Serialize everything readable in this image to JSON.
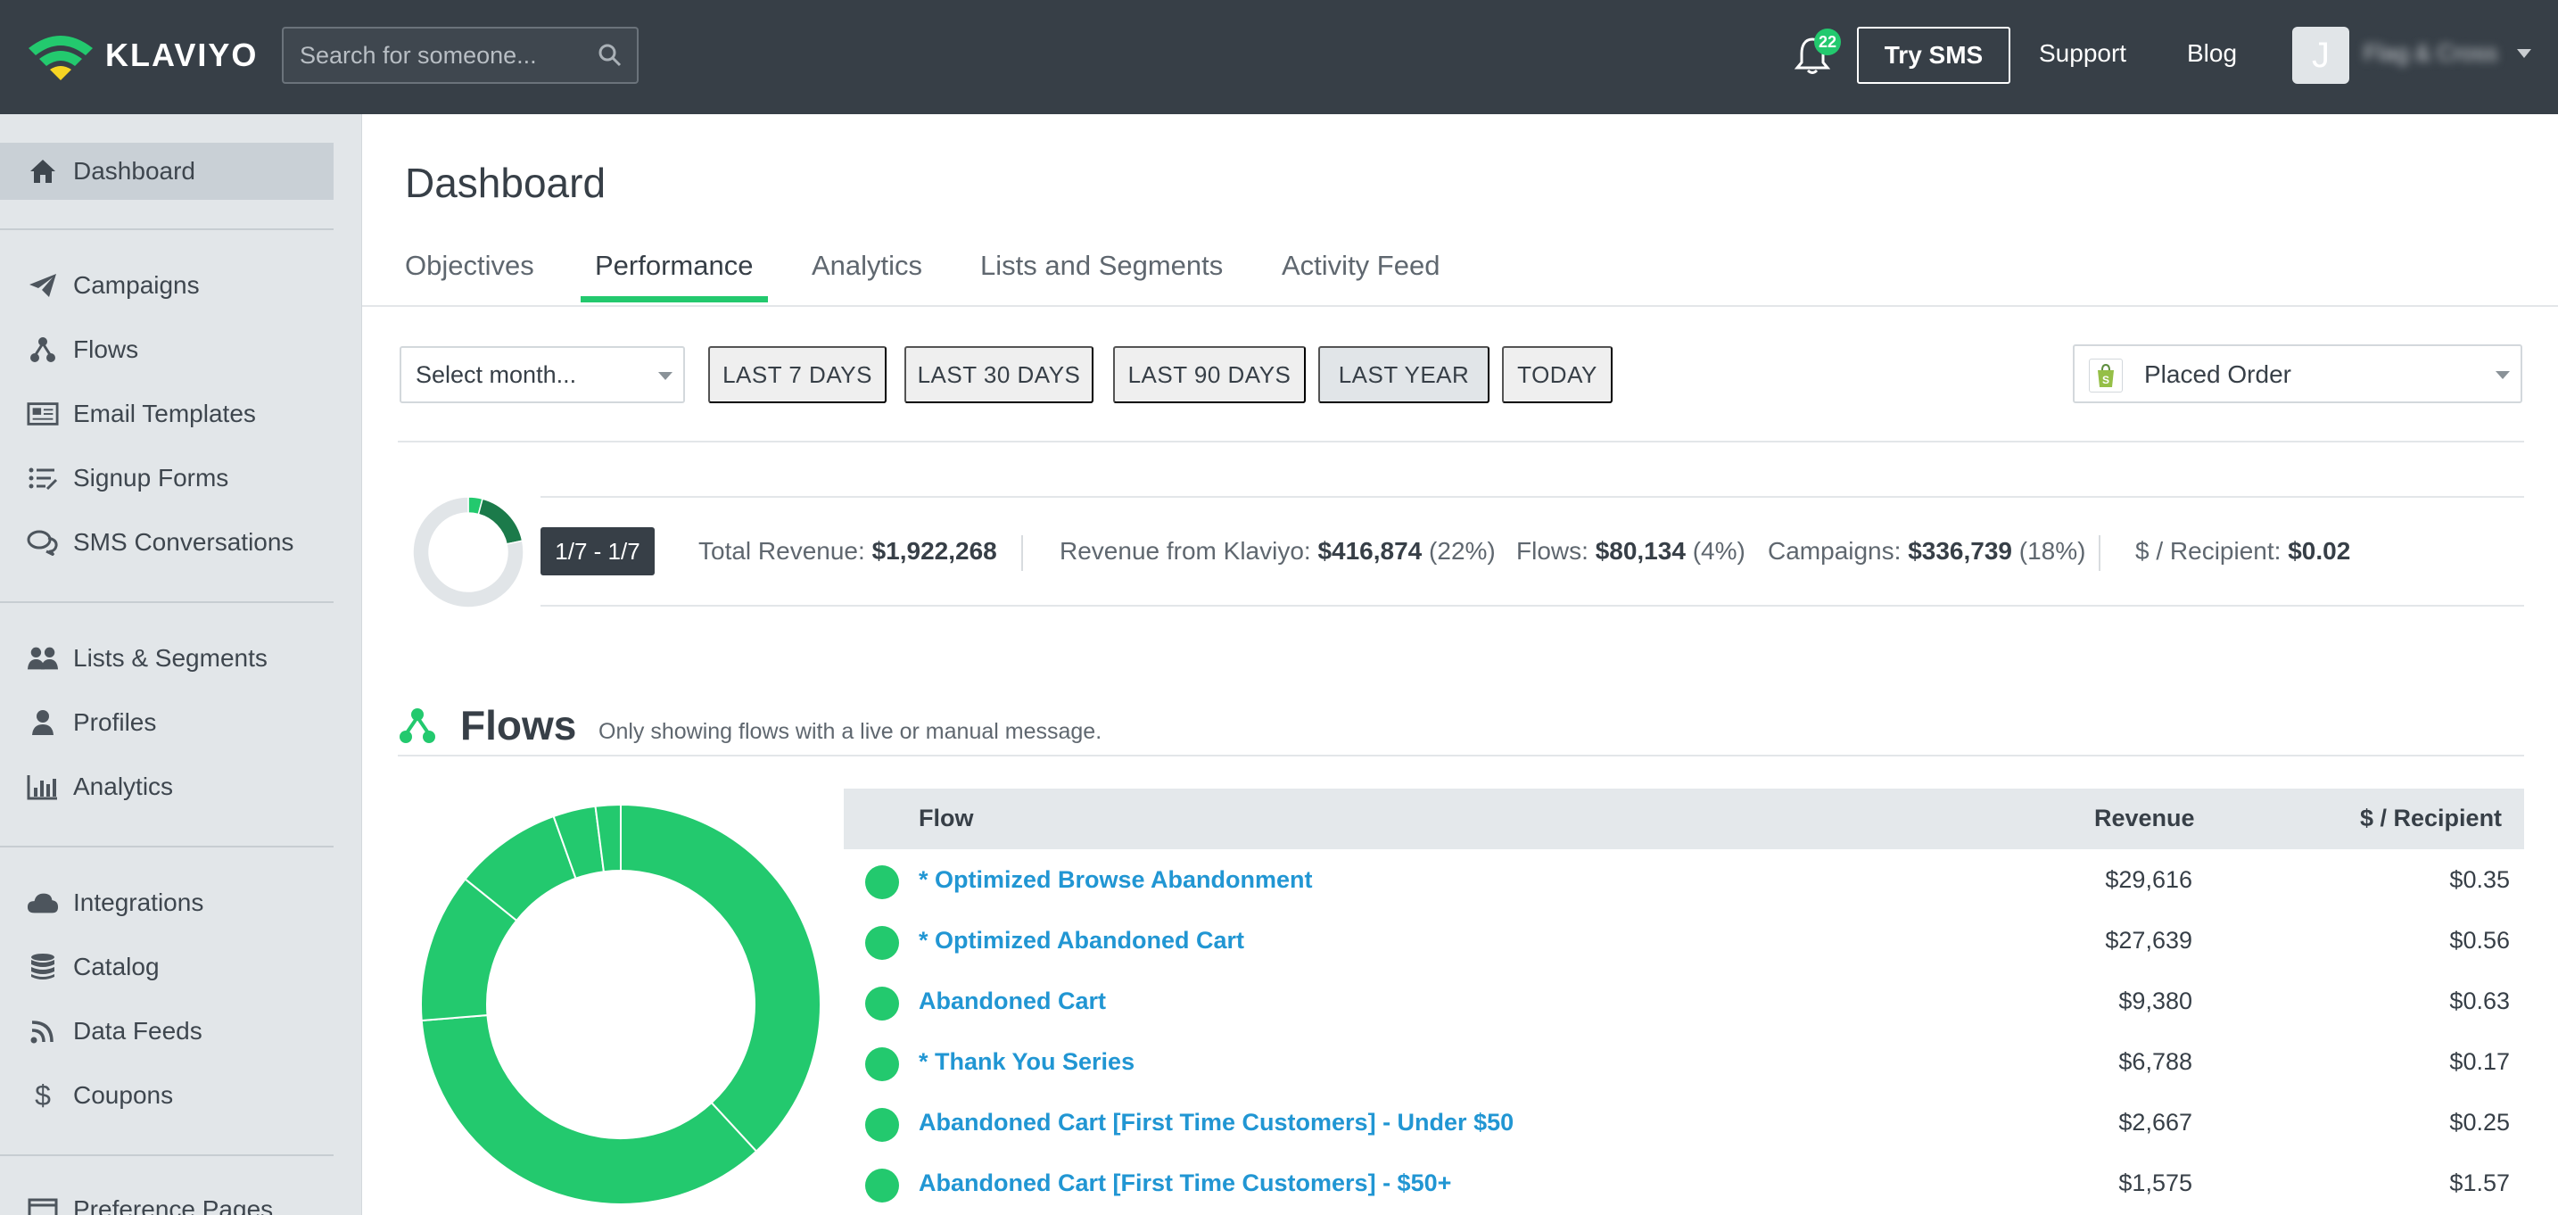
{
  "header": {
    "logo_text": "KLAVIYO",
    "search_placeholder": "Search for someone...",
    "notification_count": "22",
    "try_sms": "Try SMS",
    "support": "Support",
    "blog": "Blog",
    "avatar_initial": "J",
    "account_name": "Flag & Cross"
  },
  "sidebar": {
    "items": [
      {
        "label": "Dashboard",
        "icon": "home-icon"
      },
      {
        "label": "Campaigns",
        "icon": "paper-plane-icon"
      },
      {
        "label": "Flows",
        "icon": "flows-icon"
      },
      {
        "label": "Email Templates",
        "icon": "newspaper-icon"
      },
      {
        "label": "Signup Forms",
        "icon": "form-list-icon"
      },
      {
        "label": "SMS Conversations",
        "icon": "chat-bubbles-icon"
      },
      {
        "label": "Lists & Segments",
        "icon": "users-icon"
      },
      {
        "label": "Profiles",
        "icon": "user-icon"
      },
      {
        "label": "Analytics",
        "icon": "bar-chart-icon"
      },
      {
        "label": "Integrations",
        "icon": "cloud-icon"
      },
      {
        "label": "Catalog",
        "icon": "database-icon"
      },
      {
        "label": "Data Feeds",
        "icon": "rss-icon"
      },
      {
        "label": "Coupons",
        "icon": "dollar-icon"
      },
      {
        "label": "Preference Pages",
        "icon": "page-icon"
      }
    ]
  },
  "page": {
    "title": "Dashboard",
    "tabs": [
      "Objectives",
      "Performance",
      "Analytics",
      "Lists and Segments",
      "Activity Feed"
    ],
    "active_tab": "Performance"
  },
  "filters": {
    "month_placeholder": "Select month...",
    "ranges": [
      "LAST 7 DAYS",
      "LAST 30 DAYS",
      "LAST 90 DAYS",
      "LAST YEAR",
      "TODAY"
    ],
    "active_range": "LAST YEAR",
    "metric": "Placed Order"
  },
  "summary": {
    "date_range": "1/7 - 1/7",
    "total_revenue_label": "Total Revenue:",
    "total_revenue": "$1,922,268",
    "klaviyo_label": "Revenue from Klaviyo:",
    "klaviyo_revenue": "$416,874",
    "klaviyo_pct": "(22%)",
    "flows_label": "Flows:",
    "flows_revenue": "$80,134",
    "flows_pct": "(4%)",
    "campaigns_label": "Campaigns:",
    "campaigns_revenue": "$336,739",
    "campaigns_pct": "(18%)",
    "per_recipient_label": "$ / Recipient:",
    "per_recipient": "$0.02",
    "colors": {
      "flows": "#23c96e",
      "campaigns": "#1b7a4a",
      "other": "#e1e5e8"
    }
  },
  "flows_section": {
    "title": "Flows",
    "subtitle": "Only showing flows with a live or manual message.",
    "columns": [
      "Flow",
      "Revenue",
      "$ / Recipient"
    ],
    "rows": [
      {
        "name": "* Optimized Browse Abandonment",
        "revenue": "$29,616",
        "per_recipient": "$0.35"
      },
      {
        "name": "* Optimized Abandoned Cart",
        "revenue": "$27,639",
        "per_recipient": "$0.56"
      },
      {
        "name": "Abandoned Cart",
        "revenue": "$9,380",
        "per_recipient": "$0.63"
      },
      {
        "name": "* Thank You Series",
        "revenue": "$6,788",
        "per_recipient": "$0.17"
      },
      {
        "name": "Abandoned Cart [First Time Customers] - Under $50",
        "revenue": "$2,667",
        "per_recipient": "$0.25"
      },
      {
        "name": "Abandoned Cart [First Time Customers] - $50+",
        "revenue": "$1,575",
        "per_recipient": "$1.57"
      }
    ],
    "accent_color": "#23c96e",
    "link_color": "#2196d3"
  }
}
